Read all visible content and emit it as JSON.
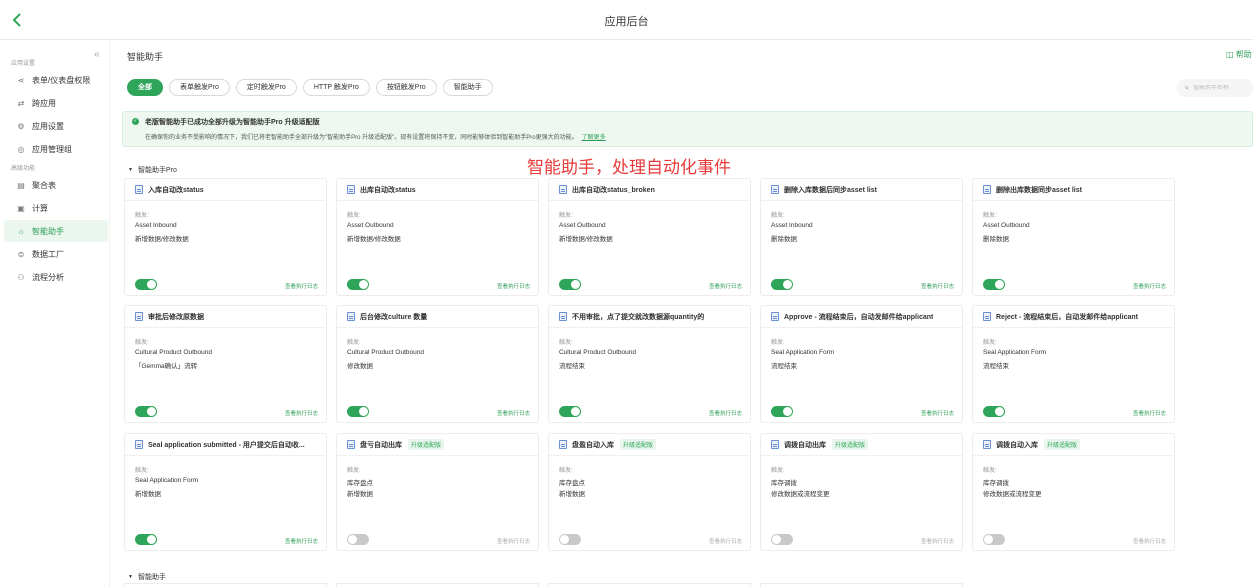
{
  "topbar": {
    "title": "应用后台"
  },
  "sidebar": {
    "groups": [
      {
        "title": "应用设置",
        "items": [
          {
            "label": "表单/仪表盘权限",
            "icon": "share-icon",
            "glyph": "⋖"
          },
          {
            "label": "跨应用",
            "icon": "link-icon",
            "glyph": "⇄"
          },
          {
            "label": "应用设置",
            "icon": "gear-icon",
            "glyph": "⚙"
          },
          {
            "label": "应用管理组",
            "icon": "shield-icon",
            "glyph": "◎"
          }
        ]
      },
      {
        "title": "高级功能",
        "items": [
          {
            "label": "聚合表",
            "icon": "table-icon",
            "glyph": "▤"
          },
          {
            "label": "计算",
            "icon": "calculator-icon",
            "glyph": "▣"
          },
          {
            "label": "智能助手",
            "icon": "bulb-icon",
            "glyph": "☼",
            "active": true
          },
          {
            "label": "数据工厂",
            "icon": "database-icon",
            "glyph": "⊜"
          },
          {
            "label": "流程分析",
            "icon": "org-icon",
            "glyph": "⚇"
          }
        ]
      }
    ]
  },
  "main": {
    "title": "智能助手",
    "help": "帮助",
    "filters": [
      "全部",
      "表单触发Pro",
      "定时触发Pro",
      "HTTP 触发Pro",
      "按钮触发Pro",
      "智能助手"
    ],
    "active_filter": 0,
    "search": {
      "placeholder": "智能助手名称"
    },
    "banner": {
      "title": "老版智能助手已成功全部升级为智能助手Pro 升级适配版",
      "text": "在确保你的业务不受影响的情况下，我们已将老智能助手全部升级为\"智能助手Pro 升级适配版\"。现有设置将保持不变，同时能够体验到智能助手Pro更强大的功能。",
      "link": "了解更多"
    },
    "annotation": "智能助手，处理自动化事件",
    "sections": [
      {
        "title": "智能助手Pro",
        "cards": [
          {
            "title": "入库自动改status",
            "trigger_label": "触发:",
            "line1": "Asset Inbound",
            "line2": "新增数据/修改数据",
            "enabled": true,
            "log": "查看执行日志"
          },
          {
            "title": "出库自动改status",
            "trigger_label": "触发:",
            "line1": "Asset Outbound",
            "line2": "新增数据/修改数据",
            "enabled": true,
            "log": "查看执行日志"
          },
          {
            "title": "出库自动改status_broken",
            "trigger_label": "触发:",
            "line1": "Asset Outbound",
            "line2": "新增数据/修改数据",
            "enabled": true,
            "log": "查看执行日志"
          },
          {
            "title": "删除入库数据后同步asset list",
            "trigger_label": "触发:",
            "line1": "Asset Inbound",
            "line2": "删除数据",
            "enabled": true,
            "log": "查看执行日志"
          },
          {
            "title": "删除出库数据同步asset list",
            "trigger_label": "触发:",
            "line1": "Asset Outbound",
            "line2": "删除数据",
            "enabled": true,
            "log": "查看执行日志"
          },
          {
            "title": "审批后修改原数据",
            "trigger_label": "触发:",
            "line1": "Cultural Product Outbound",
            "line2": "「Gemma确认」流转",
            "enabled": true,
            "log": "查看执行日志"
          },
          {
            "title": "后台修改culture 数量",
            "trigger_label": "触发:",
            "line1": "Cultural Product Outbound",
            "line2": "修改数据",
            "enabled": true,
            "log": "查看执行日志"
          },
          {
            "title": "不用审批，点了提交就改数据源quantity的",
            "trigger_label": "触发:",
            "line1": "Cultural Product Outbound",
            "line2": "流程结束",
            "enabled": true,
            "log": "查看执行日志"
          },
          {
            "title": "Approve - 流程结束后，自动发邮件给applicant",
            "trigger_label": "触发:",
            "line1": "Seal Application Form",
            "line2": "流程结束",
            "enabled": true,
            "log": "查看执行日志"
          },
          {
            "title": "Reject - 流程结束后，自动发邮件给applicant",
            "trigger_label": "触发:",
            "line1": "Seal Application Form",
            "line2": "流程结束",
            "enabled": true,
            "log": "查看执行日志"
          },
          {
            "title": "Seal application submitted - 用户提交后自动收...",
            "trigger_label": "触发:",
            "line1": "Seal Application Form",
            "line2": "新增数据",
            "enabled": true,
            "log": "查看执行日志"
          },
          {
            "title": "盘亏自动出库",
            "badge": "升级适配版",
            "trigger_label": "触发:",
            "line1": "库存盘点",
            "line2": "新增数据",
            "enabled": false,
            "log": "查看执行日志"
          },
          {
            "title": "盘盈自动入库",
            "badge": "升级适配版",
            "trigger_label": "触发:",
            "line1": "库存盘点",
            "line2": "新增数据",
            "enabled": false,
            "log": "查看执行日志"
          },
          {
            "title": "调拨自动出库",
            "badge": "升级适配版",
            "trigger_label": "触发:",
            "line1": "库存调拨",
            "line2": "修改数据或流程变更",
            "enabled": false,
            "log": "查看执行日志"
          },
          {
            "title": "调拨自动入库",
            "badge": "升级适配版",
            "trigger_label": "触发:",
            "line1": "库存调拨",
            "line2": "修改数据或流程变更",
            "enabled": false,
            "log": "查看执行日志"
          }
        ]
      },
      {
        "title": "智能助手",
        "cards": []
      }
    ]
  },
  "colors": {
    "accent": "#2fa55a",
    "annotation": "#e83a3a",
    "toggle_off": "#c9c9c9"
  }
}
